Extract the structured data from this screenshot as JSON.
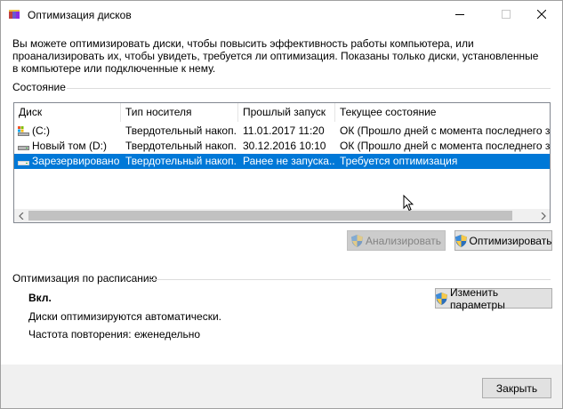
{
  "window": {
    "title": "Оптимизация дисков",
    "icon": "defrag-app-icon",
    "controls": {
      "minimize": "minimize-icon",
      "maximize": "maximize-icon",
      "close": "close-icon"
    }
  },
  "description": "Вы можете оптимизировать диски, чтобы повысить эффективность работы  компьютера, или проанализировать их, чтобы увидеть, требуется ли оптимизация. Показаны только диски, установленные в компьютере или подключенные к нему.",
  "status_section": {
    "label": "Состояние",
    "columns": [
      "Диск",
      "Тип носителя",
      "Прошлый запуск",
      "Текущее состояние"
    ],
    "rows": [
      {
        "icon": "system-drive-icon",
        "disk": "(C:)",
        "media": "Твердотельный накоп...",
        "last_run": "11.01.2017 11:20",
        "status": "ОК (Прошло дней с момента последнего запус",
        "selected": false
      },
      {
        "icon": "drive-icon",
        "disk": "Новый том (D:)",
        "media": "Твердотельный накоп...",
        "last_run": "30.12.2016 10:10",
        "status": "ОК (Прошло дней с момента последнего запус",
        "selected": false
      },
      {
        "icon": "drive-icon",
        "disk": "Зарезервировано ...",
        "media": "Твердотельный накоп...",
        "last_run": "Ранее не запуска...",
        "status": "Требуется оптимизация",
        "selected": true
      }
    ]
  },
  "buttons": {
    "analyze": "Анализировать",
    "optimize": "Оптимизировать",
    "change_settings": "Изменить параметры",
    "close": "Закрыть"
  },
  "schedule_section": {
    "label": "Оптимизация по расписанию",
    "status": "Вкл.",
    "auto_text": "Диски оптимизируются автоматически.",
    "frequency": "Частота повторения: еженедельно"
  },
  "colors": {
    "selection": "#0078d7",
    "button_face": "#e1e1e1",
    "footer": "#f0f0f0"
  }
}
